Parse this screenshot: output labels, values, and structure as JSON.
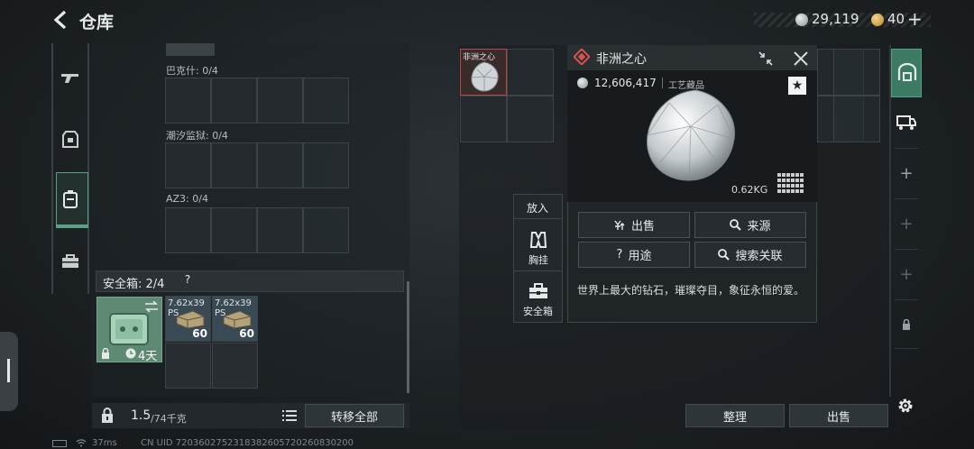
{
  "header": {
    "title": "仓库",
    "currency1": "29,119",
    "currency2": "40"
  },
  "left_rail": {
    "items": [
      "weapon-icon",
      "armor-icon",
      "backpack-icon",
      "case-icon"
    ]
  },
  "left_panel": {
    "sections": [
      {
        "label": "巴克什: 0/4"
      },
      {
        "label": "潮汐监狱: 0/4"
      },
      {
        "label": "AZ3: 0/4"
      }
    ],
    "safe_box": {
      "label": "安全箱: 2/4",
      "help": "?",
      "timer": "4天",
      "ammo": [
        {
          "line1": "7.62x39",
          "line2": "PS",
          "count": "60"
        },
        {
          "line1": "7.62x39",
          "line2": "PS",
          "count": "60"
        }
      ]
    }
  },
  "bottom_bar": {
    "weight_value": "1.5",
    "weight_unit": "/74千克",
    "transfer_all": "转移全部"
  },
  "right_panel": {
    "thumb_label": "非洲之心",
    "arrange": "整理",
    "sell": "出售"
  },
  "item_detail": {
    "name": "非洲之心",
    "price": "12,606,417",
    "category": "工艺藏品",
    "weight": "0.62KG",
    "buttons": {
      "sell": "出售",
      "source": "来源",
      "usage": "用途",
      "search": "搜索关联"
    },
    "description": "世界上最大的钻石，璀璨夺目，象征永恒的爱。"
  },
  "put_in": {
    "title": "放入",
    "vest": "胸挂",
    "safe": "安全箱"
  },
  "footer": {
    "ping": "37ms",
    "uid": "CN UID 7203602752318382605720260830200"
  },
  "colors": {
    "accent_green": "#5aa184",
    "diamond_red": "#d9534f"
  }
}
